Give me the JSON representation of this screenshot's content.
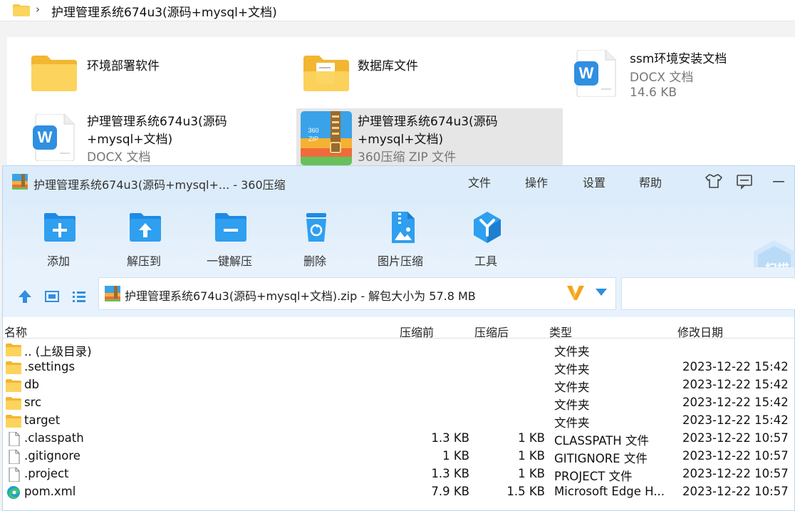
{
  "explorer": {
    "path": "护理管理系统674u3(源码+mysql+文档)",
    "items": [
      {
        "title": "环境部署软件",
        "title2": "",
        "subtitle": "",
        "size": "",
        "icon": "folder-icon"
      },
      {
        "title": "数据库文件",
        "title2": "",
        "subtitle": "",
        "size": "",
        "icon": "folder-with-doc-icon"
      },
      {
        "title": "ssm环境安装文档",
        "title2": "",
        "subtitle": "DOCX 文档",
        "size": "14.6 KB",
        "icon": "wps-docx-icon"
      },
      {
        "title": "护理管理系统674u3(源码",
        "title2": "+mysql+文档)",
        "subtitle": "DOCX 文档",
        "size": "",
        "icon": "wps-docx-icon"
      },
      {
        "title": "护理管理系统674u3(源码",
        "title2": "+mysql+文档)",
        "subtitle": "360压缩 ZIP 文件",
        "size": "",
        "icon": "zip-archive-icon"
      }
    ]
  },
  "zip_window": {
    "title": "护理管理系统674u3(源码+mysql+... - 360压缩",
    "menu": [
      "文件",
      "操作",
      "设置",
      "帮助"
    ],
    "toolbar": [
      {
        "label": "添加",
        "icon": "add-icon"
      },
      {
        "label": "解压到",
        "icon": "extract-to-icon"
      },
      {
        "label": "一键解压",
        "icon": "one-click-extract-icon"
      },
      {
        "label": "删除",
        "icon": "delete-icon"
      },
      {
        "label": "图片压缩",
        "icon": "image-compress-icon"
      },
      {
        "label": "工具",
        "icon": "tools-icon"
      }
    ],
    "scan_label": "扫描",
    "path_text": "护理管理系统674u3(源码+mysql+文档).zip - 解包大小为 57.8 MB",
    "columns": [
      "名称",
      "压缩前",
      "压缩后",
      "类型",
      "修改日期"
    ],
    "rows": [
      {
        "name": ".. (上级目录)",
        "compressed_before": "",
        "compressed_after": "",
        "type": "文件夹",
        "date": "",
        "icon": "folder-icon"
      },
      {
        "name": ".settings",
        "compressed_before": "",
        "compressed_after": "",
        "type": "文件夹",
        "date": "2023-12-22 15:42",
        "icon": "folder-icon"
      },
      {
        "name": "db",
        "compressed_before": "",
        "compressed_after": "",
        "type": "文件夹",
        "date": "2023-12-22 15:42",
        "icon": "folder-icon"
      },
      {
        "name": "src",
        "compressed_before": "",
        "compressed_after": "",
        "type": "文件夹",
        "date": "2023-12-22 15:42",
        "icon": "folder-icon"
      },
      {
        "name": "target",
        "compressed_before": "",
        "compressed_after": "",
        "type": "文件夹",
        "date": "2023-12-22 15:42",
        "icon": "folder-icon"
      },
      {
        "name": ".classpath",
        "compressed_before": "1.3 KB",
        "compressed_after": "1 KB",
        "type": "CLASSPATH 文件",
        "date": "2023-12-22 10:57",
        "icon": "file-icon"
      },
      {
        "name": ".gitignore",
        "compressed_before": "1 KB",
        "compressed_after": "1 KB",
        "type": "GITIGNORE 文件",
        "date": "2023-12-22 10:57",
        "icon": "file-icon"
      },
      {
        "name": ".project",
        "compressed_before": "1.3 KB",
        "compressed_after": "1 KB",
        "type": "PROJECT 文件",
        "date": "2023-12-22 10:57",
        "icon": "file-icon"
      },
      {
        "name": "pom.xml",
        "compressed_before": "7.9 KB",
        "compressed_after": "1.5 KB",
        "type": "Microsoft Edge H...",
        "date": "2023-12-22 10:57",
        "icon": "edge-icon"
      }
    ]
  },
  "colors": {
    "accent_blue": "#2f8fe0",
    "title_bg": "#dcecfa",
    "folder_yellow": "#f8c94a"
  }
}
